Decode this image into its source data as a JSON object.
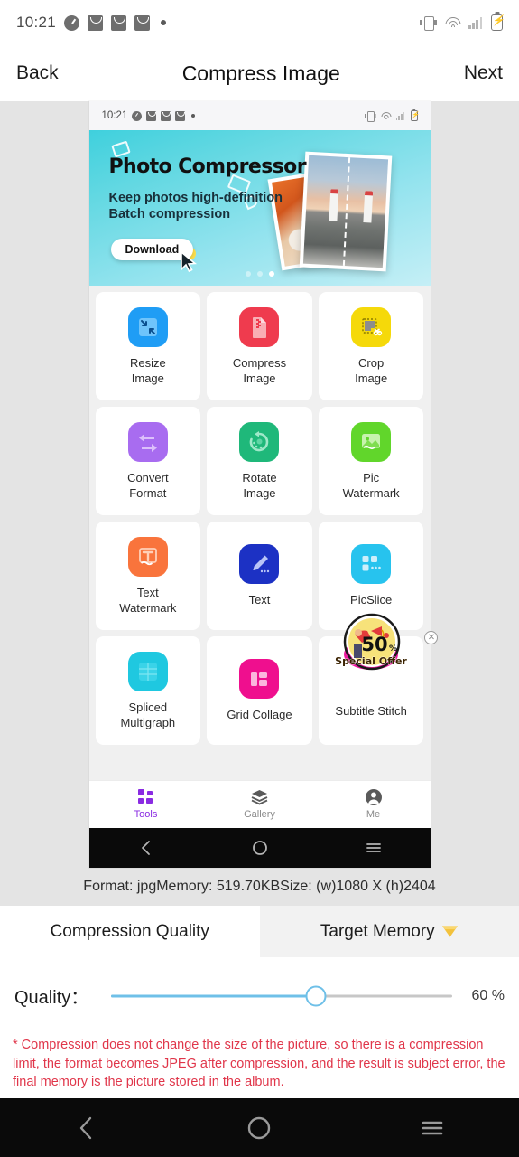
{
  "status_bar": {
    "time": "10:21",
    "icons_left": [
      "clock-icon",
      "mail-icon",
      "mail-icon",
      "mail-icon",
      "dot-icon"
    ],
    "icons_right": [
      "vibrate-icon",
      "wifi-icon",
      "signal-icon",
      "battery-charging-icon"
    ]
  },
  "header": {
    "back_label": "Back",
    "title": "Compress Image",
    "next_label": "Next"
  },
  "preview": {
    "status_bar": {
      "time": "10:21"
    },
    "banner": {
      "title": "Photo Compressor",
      "subtitle_line1": "Keep photos high-definition",
      "subtitle_line2": "Batch compression",
      "cta_label": "Download",
      "carousel_dots": 3,
      "active_dot": 3,
      "gradient_from": "#3fd0dd",
      "gradient_to": "#c5eff6"
    },
    "tools": [
      {
        "label_line1": "Resize",
        "label_line2": "Image",
        "icon": "resize-icon",
        "color": "#1f9df5"
      },
      {
        "label_line1": "Compress",
        "label_line2": "Image",
        "icon": "compress-file-icon",
        "color": "#ef3b4e"
      },
      {
        "label_line1": "Crop",
        "label_line2": "Image",
        "icon": "crop-scissors-icon",
        "color": "#f5d90a"
      },
      {
        "label_line1": "Convert",
        "label_line2": "Format",
        "icon": "convert-arrows-icon",
        "color": "#a86cf0"
      },
      {
        "label_line1": "Rotate",
        "label_line2": "Image",
        "icon": "rotate-icon",
        "color": "#1fb87a"
      },
      {
        "label_line1": "Pic",
        "label_line2": "Watermark",
        "icon": "photo-watermark-icon",
        "color": "#61d62b"
      },
      {
        "label_line1": "Text",
        "label_line2": "Watermark",
        "icon": "text-watermark-icon",
        "color": "#f9743c"
      },
      {
        "label_line1": "Text",
        "label_line2": "",
        "icon": "pencil-icon",
        "color": "#1c31c4"
      },
      {
        "label_line1": "PicSlice",
        "label_line2": "",
        "icon": "picslice-grid-icon",
        "color": "#27c3ee"
      },
      {
        "label_line1": "Spliced",
        "label_line2": "Multigraph",
        "icon": "spliced-panels-icon",
        "color": "#1fc8e0"
      },
      {
        "label_line1": "Grid Collage",
        "label_line2": "",
        "icon": "grid-collage-icon",
        "color": "#ef0f8e"
      },
      {
        "label_line1": "Subtitle Stitch",
        "label_line2": "",
        "icon": "subtitle-stitch-icon",
        "color": "#ffffff"
      }
    ],
    "ad": {
      "offer_number": "50",
      "offer_percent": "%",
      "offer_text": "Special Offer",
      "close_icon": "close-circle-icon"
    },
    "bottom_tabs": [
      {
        "label": "Tools",
        "icon": "grid-squares-icon",
        "active": true
      },
      {
        "label": "Gallery",
        "icon": "layers-icon",
        "active": false
      },
      {
        "label": "Me",
        "icon": "person-icon",
        "active": false
      }
    ],
    "nav_icons": [
      "back-chevron-icon",
      "home-circle-icon",
      "recents-menu-icon"
    ]
  },
  "info_line": "Format: jpgMemory: 519.70KBSize: (w)1080 X (h)2404",
  "mode_tabs": [
    {
      "label": "Compression Quality",
      "active": true,
      "badge": null
    },
    {
      "label": "Target Memory",
      "active": false,
      "badge": "gem-icon"
    }
  ],
  "quality": {
    "label": "Quality：",
    "value_text": "60 %",
    "value": 60,
    "min": 0,
    "max": 100,
    "fill_color": "#6fc0e8",
    "track_color": "#c7c7c7"
  },
  "warning": {
    "text": "* Compression does not change the size of the picture, so there is a compression limit, the format becomes JPEG after compression, and the result is subject error, the final memory is the picture stored in the album.",
    "color": "#e0364a"
  },
  "system_nav": {
    "icons": [
      "back-chevron-icon",
      "home-circle-icon",
      "recents-menu-icon"
    ]
  }
}
